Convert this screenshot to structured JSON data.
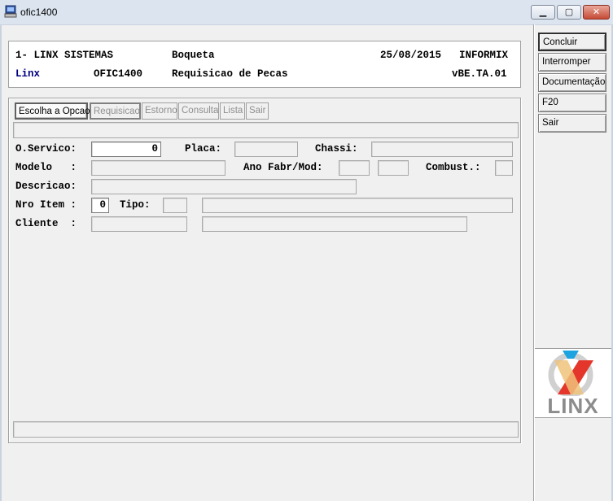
{
  "window": {
    "title": "ofic1400"
  },
  "header": {
    "company": "1- LINX SISTEMAS",
    "location": "Boqueta",
    "date": "25/08/2015",
    "db": "INFORMIX",
    "user": "Linx",
    "program": "OFIC1400",
    "screen_title": "Requisicao de Pecas",
    "version": "vBE.TA.01"
  },
  "tabs": [
    {
      "label": "Escolha a Opcao",
      "state": "active"
    },
    {
      "label": "Requisicao",
      "state": "disabled"
    },
    {
      "label": "Estorno",
      "state": "disabled"
    },
    {
      "label": "Consulta",
      "state": "disabled"
    },
    {
      "label": "Lista",
      "state": "disabled"
    },
    {
      "label": "Sair",
      "state": "disabled"
    }
  ],
  "form": {
    "os_label": "O.Servico:",
    "os_value": "0",
    "placa_label": "Placa:",
    "chassi_label": "Chassi:",
    "modelo_label": "Modelo   :",
    "ano_label": "Ano Fabr/Mod:",
    "combust_label": "Combust.:",
    "descricao_label": "Descricao:",
    "nro_item_label": "Nro Item :",
    "nro_item_value": "0",
    "tipo_label": "Tipo:",
    "cliente_label": "Cliente  :"
  },
  "side_buttons": {
    "concluir": "Concluir",
    "interromper": "Interromper",
    "documentacao": "Documentação",
    "f20": "F20",
    "sair": "Sair"
  },
  "logo": {
    "text": "LINX"
  },
  "colors": {
    "label_navy": "#000080",
    "logo_blue": "#1ca3e0",
    "logo_red": "#e4362b"
  }
}
